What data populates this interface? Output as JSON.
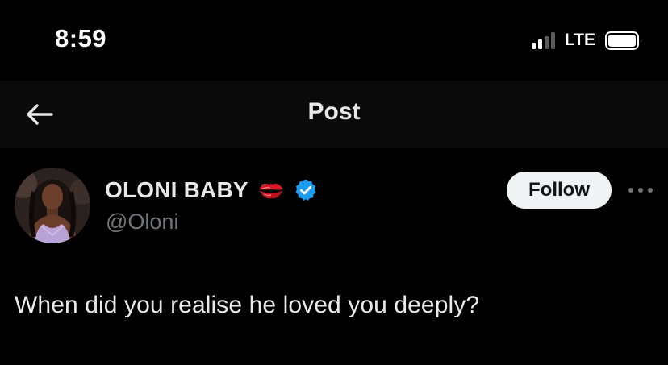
{
  "status_bar": {
    "time": "8:59",
    "network": "LTE",
    "icons": {
      "signal": "cellular-signal-icon",
      "battery": "battery-icon"
    }
  },
  "header": {
    "title": "Post",
    "back_icon": "back-arrow-icon"
  },
  "post": {
    "author": {
      "display_name": "OLONI BABY",
      "handle": "@Oloni",
      "emoji_icon": "kiss-mark-icon",
      "verified_icon": "verified-badge-icon",
      "verified_color": "#1d9bf0"
    },
    "follow_label": "Follow",
    "more_icon": "more-options-icon",
    "text": "When did you realise he loved you deeply?"
  },
  "colors": {
    "background": "#000000",
    "header_background": "#0a0a0a",
    "primary_text": "#e7e9ea",
    "secondary_text": "#71767b",
    "button_background": "#eff3f4",
    "button_text": "#0f1419",
    "kiss_red": "#d9182b"
  }
}
